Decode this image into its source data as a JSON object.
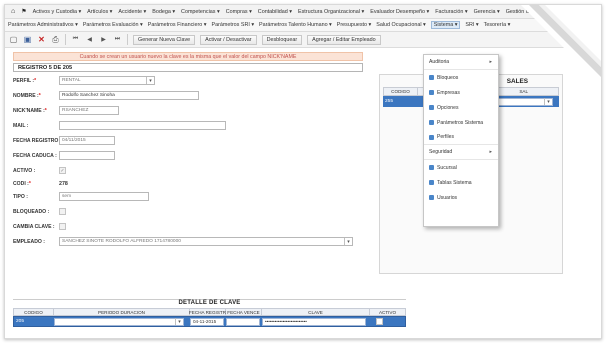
{
  "menu_top": [
    "Activos y Custodia ▾",
    "Artículos ▾",
    "Accidente ▾",
    "Bodega ▾",
    "Competencias ▾",
    "Compras ▾",
    "Contabilidad ▾",
    "Estructura Organizacional ▾",
    "Evaluador Desempeño ▾",
    "Facturación ▾",
    "Gerencia ▾",
    "Gestión de Talento Hu"
  ],
  "menu_second": [
    "Parámetros Administrativos ▾",
    "Parámetros Evaluación ▾",
    "Parámetros Financiero ▾",
    "Parámetros SRI ▾",
    "Parámetros Talento Humano ▾",
    "Presupuesto ▾",
    "Salud Ocupacional ▾",
    "Sistema ▾",
    "SRI ▾",
    "Tesorería ▾"
  ],
  "toolbar": {
    "generate_key": "Generar Nueva Clave",
    "activate": "Activar / Desactivar",
    "unlock": "Desbloquear",
    "add_employee": "Agregar / Editar Empleado"
  },
  "warning": "Cuando se crean un usuario nuevo la clave es la misma que el valor del campo NICK'NAME",
  "register_header": "REGISTRO 5 DE 205",
  "form": {
    "perfil_label": "PERFIL :",
    "perfil_value": "RENTAL",
    "nombre_label": "NOMBRE :",
    "nombre_value": "Rodolfo Sanchez Sinoha",
    "nick_label": "NICK'NAME :",
    "nick_value": "RSANCHEZ",
    "mail_label": "MAIL :",
    "mail_value": "",
    "fecha_registro_label": "FECHA REGISTRO :",
    "fecha_registro_value": "04/11/2015",
    "fecha_caduca_label": "FECHA CADUCA :",
    "fecha_caduca_value": "",
    "activo_label": "ACTIVO :",
    "codi_label": "CODI :",
    "codi_value": "278",
    "tipo_label": "TIPO :",
    "tipo_value": "sem",
    "bloqueado_label": "BLOQUEADO :",
    "cambia_label": "CAMBIA CLAVE :",
    "empleado_label": "EMPLEADO :",
    "empleado_value": "SANCHEZ SINOTE RODOLFO ALFREDO 1714780000"
  },
  "detalle": {
    "title": "DETALLE DE CLAVE",
    "headers": [
      "CODIGO",
      "PERIODO DURACION",
      "FECHA REGISTR",
      "FECHA VENCE",
      "CLAVE",
      "ACTIVO"
    ],
    "row": {
      "codigo": "205",
      "fecha_registro": "04-11-2015",
      "clave": "••••••••••••••••••••••••••"
    }
  },
  "right_panel": {
    "title": "SALES",
    "headers": [
      "CODIGO",
      "SAL"
    ],
    "row_code": "255"
  },
  "dropdown": {
    "items": [
      "Auditoria",
      "Bloqueos",
      "Empresas",
      "Opciones",
      "Parámetros Sistema",
      "Perfiles",
      "Seguridad",
      "Sucursal",
      "Tablas Sistema",
      "Usuarios"
    ]
  }
}
